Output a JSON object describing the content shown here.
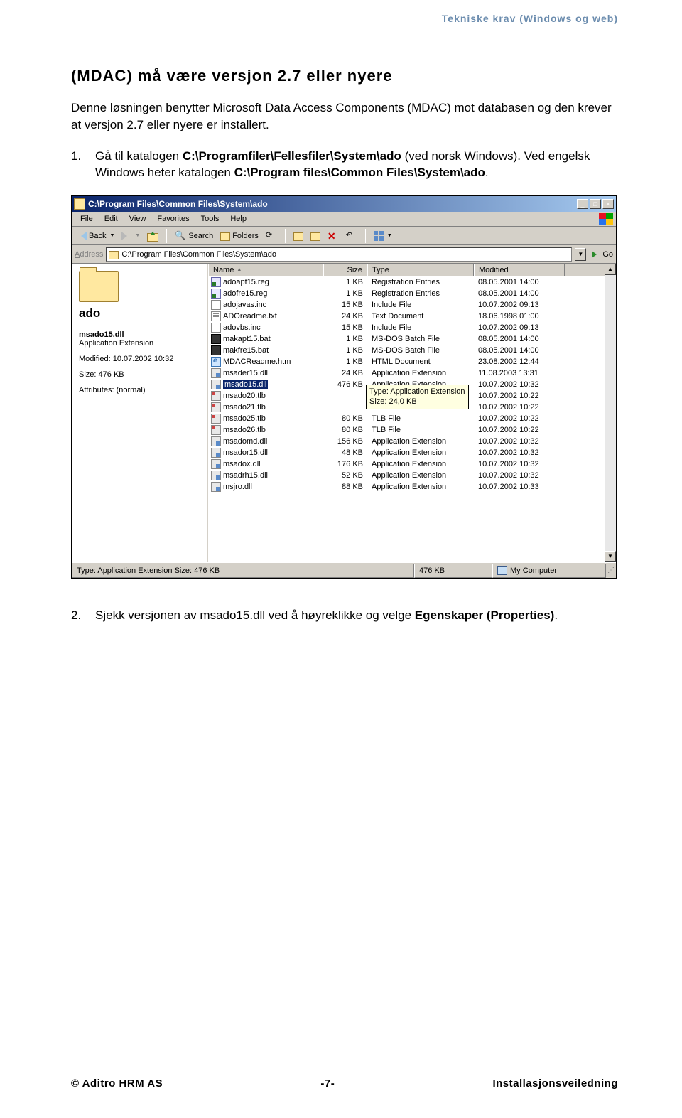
{
  "page_header": "Tekniske krav (Windows og web)",
  "heading": "(MDAC) må være versjon 2.7 eller nyere",
  "intro": "Denne løsningen benytter Microsoft Data Access Components (MDAC) mot databasen og den krever at versjon 2.7 eller nyere er installert.",
  "step1_pre": "Gå til katalogen ",
  "step1_path1": "C:\\Programfiler\\Fellesfiler\\System\\ado",
  "step1_mid": " (ved norsk Windows). Ved engelsk Windows heter katalogen ",
  "step1_path2": "C:\\Program files\\Common Files\\System\\ado",
  "step1_end": ".",
  "step2_pre": "Sjekk versjonen av msado15.dll ved å høyreklikke og velge ",
  "step2_bold": "Egenskaper (Properties)",
  "step2_end": ".",
  "explorer": {
    "title": "C:\\Program Files\\Common Files\\System\\ado",
    "winmin": "_",
    "winmax": "□",
    "winclose": "×",
    "menu": [
      "File",
      "Edit",
      "View",
      "Favorites",
      "Tools",
      "Help"
    ],
    "back": "Back",
    "search": "Search",
    "folders": "Folders",
    "addr_label": "Address",
    "addr_value": "C:\\Program Files\\Common Files\\System\\ado",
    "go": "Go",
    "left": {
      "folder": "ado",
      "selname": "msado15.dll",
      "seltype": "Application Extension",
      "modlbl": "Modified:",
      "modval": "10.07.2002 10:32",
      "sizelbl": "Size:",
      "sizeval": "476 KB",
      "attrlbl": "Attributes:",
      "attrval": "(normal)"
    },
    "cols": {
      "name": "Name",
      "size": "Size",
      "type": "Type",
      "mod": "Modified"
    },
    "tooltip_l1": "Type: Application Extension",
    "tooltip_l2": "Size: 24,0 KB",
    "files": [
      {
        "ico": "reg",
        "n": "adoapt15.reg",
        "s": "1 KB",
        "t": "Registration Entries",
        "m": "08.05.2001 14:00",
        "sel": false
      },
      {
        "ico": "reg",
        "n": "adofre15.reg",
        "s": "1 KB",
        "t": "Registration Entries",
        "m": "08.05.2001 14:00",
        "sel": false
      },
      {
        "ico": "inc",
        "n": "adojavas.inc",
        "s": "15 KB",
        "t": "Include File",
        "m": "10.07.2002 09:13",
        "sel": false
      },
      {
        "ico": "txt",
        "n": "ADOreadme.txt",
        "s": "24 KB",
        "t": "Text Document",
        "m": "18.06.1998 01:00",
        "sel": false
      },
      {
        "ico": "inc",
        "n": "adovbs.inc",
        "s": "15 KB",
        "t": "Include File",
        "m": "10.07.2002 09:13",
        "sel": false
      },
      {
        "ico": "bat",
        "n": "makapt15.bat",
        "s": "1 KB",
        "t": "MS-DOS Batch File",
        "m": "08.05.2001 14:00",
        "sel": false
      },
      {
        "ico": "bat",
        "n": "makfre15.bat",
        "s": "1 KB",
        "t": "MS-DOS Batch File",
        "m": "08.05.2001 14:00",
        "sel": false
      },
      {
        "ico": "htm",
        "n": "MDACReadme.htm",
        "s": "1 KB",
        "t": "HTML Document",
        "m": "23.08.2002 12:44",
        "sel": false
      },
      {
        "ico": "dll",
        "n": "msader15.dll",
        "s": "24 KB",
        "t": "Application Extension",
        "m": "11.08.2003 13:31",
        "sel": false
      },
      {
        "ico": "dll",
        "n": "msado15.dll",
        "s": "476 KB",
        "t": "Application Extension",
        "m": "10.07.2002 10:32",
        "sel": true
      },
      {
        "ico": "tlb",
        "n": "msado20.tlb",
        "s": "",
        "t": "",
        "m": "10.07.2002 10:22",
        "sel": false
      },
      {
        "ico": "tlb",
        "n": "msado21.tlb",
        "s": "",
        "t": "",
        "m": "10.07.2002 10:22",
        "sel": false
      },
      {
        "ico": "tlb",
        "n": "msado25.tlb",
        "s": "80 KB",
        "t": "TLB File",
        "m": "10.07.2002 10:22",
        "sel": false
      },
      {
        "ico": "tlb",
        "n": "msado26.tlb",
        "s": "80 KB",
        "t": "TLB File",
        "m": "10.07.2002 10:22",
        "sel": false
      },
      {
        "ico": "dll",
        "n": "msadomd.dll",
        "s": "156 KB",
        "t": "Application Extension",
        "m": "10.07.2002 10:32",
        "sel": false
      },
      {
        "ico": "dll",
        "n": "msador15.dll",
        "s": "48 KB",
        "t": "Application Extension",
        "m": "10.07.2002 10:32",
        "sel": false
      },
      {
        "ico": "dll",
        "n": "msadox.dll",
        "s": "176 KB",
        "t": "Application Extension",
        "m": "10.07.2002 10:32",
        "sel": false
      },
      {
        "ico": "dll",
        "n": "msadrh15.dll",
        "s": "52 KB",
        "t": "Application Extension",
        "m": "10.07.2002 10:32",
        "sel": false
      },
      {
        "ico": "dll",
        "n": "msjro.dll",
        "s": "88 KB",
        "t": "Application Extension",
        "m": "10.07.2002 10:33",
        "sel": false
      }
    ],
    "status_l": "Type: Application Extension Size: 476 KB",
    "status_m": "476 KB",
    "status_r": "My Computer"
  },
  "footer": {
    "left": "© Aditro HRM AS",
    "center": "-7-",
    "right": "Installasjonsveiledning"
  }
}
